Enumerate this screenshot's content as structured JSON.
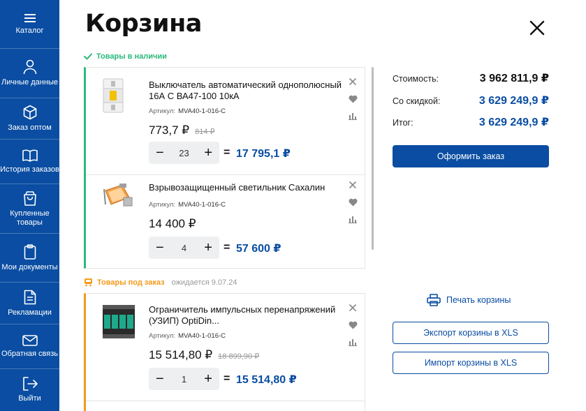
{
  "sidebar": {
    "items": [
      {
        "label": "Каталог",
        "icon": "menu-icon"
      },
      {
        "label": "Личные данные",
        "icon": "user-icon"
      },
      {
        "label": "Заказ оптом",
        "icon": "cube-icon"
      },
      {
        "label": "История заказов",
        "icon": "book-icon"
      },
      {
        "label": "Купленные товары",
        "icon": "bag-icon"
      },
      {
        "label": "Мои документы",
        "icon": "clipboard-icon"
      },
      {
        "label": "Рекламации",
        "icon": "document-icon"
      },
      {
        "label": "Обратная связь",
        "icon": "envelope-icon"
      },
      {
        "label": "Выйти",
        "icon": "logout-icon"
      }
    ]
  },
  "page": {
    "title": "Корзина"
  },
  "sections": {
    "in_stock": {
      "label": "Товары в наличии"
    },
    "on_order": {
      "label": "Товары под заказ",
      "expected": "ожидается 9.07.24"
    }
  },
  "items": [
    {
      "name": "Выключатель автоматический однополюсный 16А С ВА47-100 10кА",
      "article_label": "Артикул:",
      "article": "MVA40-1-016-C",
      "price": "773,7 ₽",
      "old_price": "814 ₽",
      "qty": "23",
      "total": "17 795,1 ₽"
    },
    {
      "name": "Взрывозащищенный светильник Сахалин",
      "article_label": "Артикул:",
      "article": "MVA40-1-016-C",
      "price": "14 400 ₽",
      "old_price": "",
      "qty": "4",
      "total": "57 600 ₽"
    },
    {
      "name": "Ограничитель импульсных перенапряжений (УЗИП) OptiDin...",
      "article_label": "Артикул:",
      "article": "MVA40-1-016-C",
      "price": "15 514,80 ₽",
      "old_price": "18 899,90 ₽",
      "qty": "1",
      "total": "15 514,80 ₽"
    }
  ],
  "summary": {
    "cost_label": "Стоимость:",
    "cost": "3 962 811,9 ₽",
    "discount_label": "Со скидкой:",
    "discount": "3 629 249,9 ₽",
    "total_label": "Итог:",
    "total": "3 629 249,9 ₽",
    "checkout": "Оформить заказ",
    "print": "Печать корзины",
    "export": "Экспорт корзины в XLS",
    "import": "Импорт корзины в XLS"
  },
  "colors": {
    "brand": "#0a4da2",
    "in_stock": "#2ab97a",
    "on_order": "#f49a1a"
  }
}
